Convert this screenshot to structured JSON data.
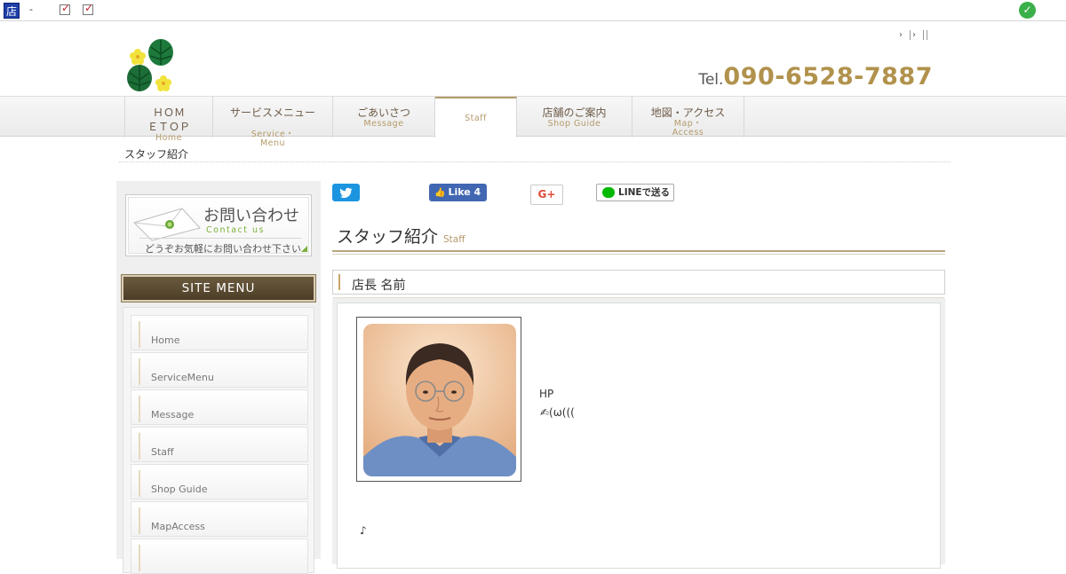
{
  "adminbar": {
    "store_icon": "店",
    "dash": "-",
    "checkbox_icons": [
      "checkbox-checked-icon",
      "checkbox-checked-icon"
    ],
    "status_icon": "check-circle-icon"
  },
  "header": {
    "toplinks": [
      "›",
      "›"
    ],
    "tel_prefix": "Tel.",
    "tel_number": "090-6528-7887",
    "accent_color": "#b1924c"
  },
  "nav": [
    {
      "jp_line1": "ＨＯＭ",
      "jp_line2": "ＥＴＯＰ",
      "en": "Home"
    },
    {
      "jp_line1": "サービスメニュー",
      "en": "Service・",
      "en2": "Menu"
    },
    {
      "jp_line1": "ごあいさつ",
      "en": "Message"
    },
    {
      "jp_line1": "",
      "en": "Staff",
      "active": true
    },
    {
      "jp_line1": "店舗のご案内",
      "en": "Shop Guide"
    },
    {
      "jp_line1": "地図・アクセス",
      "en": "Map・",
      "en2": "Access"
    }
  ],
  "breadcrumb": "スタッフ紹介",
  "sidebar": {
    "contact": {
      "title": "お問い合わせ",
      "subtitle": "Contact us",
      "description": "どうぞお気軽にお問い合わせ下さい"
    },
    "site_menu_title": "SITE MENU",
    "menu_items": [
      "Home",
      "ServiceMenu",
      "Message",
      "Staff",
      "Shop Guide",
      "MapAccess",
      ""
    ]
  },
  "social": {
    "facebook_label": "Like 4",
    "google_label": "G+",
    "line_label": "LINEで送る"
  },
  "main": {
    "title_jp": "スタッフ紹介",
    "title_en": "Staff",
    "section_title": "店長 名前",
    "text_line1": "HP",
    "text_line2": "✍(ω(((",
    "text_line3": "♪"
  }
}
